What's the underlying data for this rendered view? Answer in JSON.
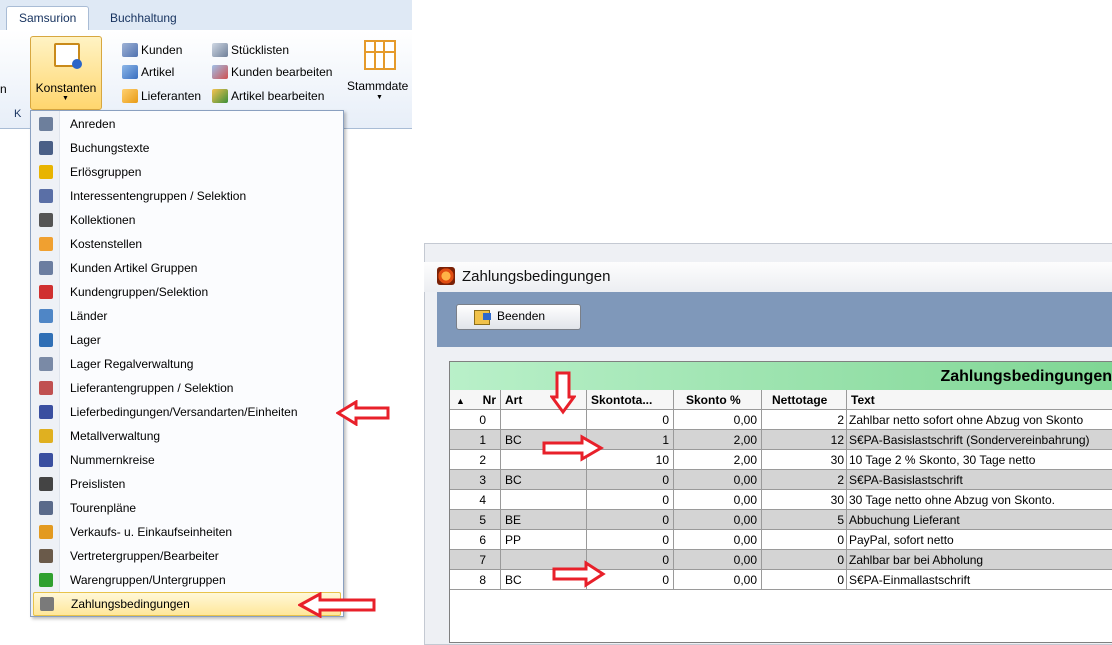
{
  "ribbon": {
    "tabs": [
      {
        "label": "Samsurion",
        "active": true
      },
      {
        "label": "Buchhaltung",
        "active": false
      }
    ],
    "constants_button": "Konstanten",
    "small_buttons": [
      {
        "label": "Kunden",
        "icon": "customers-icon"
      },
      {
        "label": "Artikel",
        "icon": "article-icon"
      },
      {
        "label": "Lieferanten",
        "icon": "suppliers-icon"
      },
      {
        "label": "Stücklisten",
        "icon": "bill-of-materials-icon"
      },
      {
        "label": "Kunden bearbeiten",
        "icon": "edit-customers-icon"
      },
      {
        "label": "Artikel bearbeiten",
        "icon": "edit-articles-icon"
      }
    ],
    "stammdaten_label": "Stammdate",
    "left_edge_text": "n",
    "group_label": "K"
  },
  "menu": {
    "items": [
      {
        "label": "Anreden",
        "icon": "people-icon",
        "color": "#6d7f9c"
      },
      {
        "label": "Buchungstexte",
        "icon": "text-lines-icon",
        "color": "#4a5f86"
      },
      {
        "label": "Erlösgruppen",
        "icon": "star-burst-icon",
        "color": "#e8b400"
      },
      {
        "label": "Interessentengruppen / Selektion",
        "icon": "person-question-icon",
        "color": "#5a6fa6"
      },
      {
        "label": "Kollektionen",
        "icon": "caret-up-icon",
        "color": "#555555"
      },
      {
        "label": "Kostenstellen",
        "icon": "grid-orange-icon",
        "color": "#f0a030"
      },
      {
        "label": "Kunden Artikel Gruppen",
        "icon": "customer-article-icon",
        "color": "#6b7da0"
      },
      {
        "label": "Kundengruppen/Selektion",
        "icon": "colored-people-icon",
        "color": "#d03030"
      },
      {
        "label": "Länder",
        "icon": "landscape-icon",
        "color": "#4f86c6"
      },
      {
        "label": "Lager",
        "icon": "box-icon",
        "color": "#2f6fb5"
      },
      {
        "label": "Lager Regalverwaltung",
        "icon": "shelf-icon",
        "color": "#7a8aa6"
      },
      {
        "label": "Lieferantengruppen / Selektion",
        "icon": "supplier-group-icon",
        "color": "#c05050"
      },
      {
        "label": "Lieferbedingungen/Versandarten/Einheiten",
        "icon": "code-brackets-icon",
        "color": "#3a4fa0"
      },
      {
        "label": "Metallverwaltung",
        "icon": "metal-icon",
        "color": "#e0b020"
      },
      {
        "label": "Nummernkreise",
        "icon": "code-brackets-icon",
        "color": "#3a4fa0"
      },
      {
        "label": "Preislisten",
        "icon": "list-icon",
        "color": "#444444"
      },
      {
        "label": "Tourenpläne",
        "icon": "route-icon",
        "color": "#5a6a8a"
      },
      {
        "label": "Verkaufs- u. Einkaufseinheiten",
        "icon": "units-icon",
        "color": "#e39a20"
      },
      {
        "label": "Vertretergruppen/Bearbeiter",
        "icon": "agent-icon",
        "color": "#6a5a4a"
      },
      {
        "label": "Warengruppen/Untergruppen",
        "icon": "plus-icon",
        "color": "#2fa02f"
      },
      {
        "label": "Zahlungsbedingungen",
        "icon": "payment-terms-icon",
        "color": "#7a7a7a"
      }
    ],
    "highlighted": "Zahlungsbedingungen"
  },
  "window": {
    "title": "Zahlungsbedingungen",
    "close_button": "Beenden",
    "grid_title": "Zahlungsbedingungen",
    "columns": [
      "Nr",
      "Art",
      "Skontota...",
      "Skonto %",
      "Nettotage",
      "Text"
    ],
    "sort_indicator": "▲",
    "rows": [
      {
        "nr": "0",
        "art": "",
        "skontotage": "0",
        "skonto": "0,00",
        "nettotage": "2",
        "text": "Zahlbar netto sofort ohne Abzug von Skonto"
      },
      {
        "nr": "1",
        "art": "BC",
        "skontotage": "1",
        "skonto": "2,00",
        "nettotage": "12",
        "text": "S€PA-Basislastschrift (Sondervereinbahrung)"
      },
      {
        "nr": "2",
        "art": "",
        "skontotage": "10",
        "skonto": "2,00",
        "nettotage": "30",
        "text": "10 Tage 2 % Skonto, 30 Tage netto"
      },
      {
        "nr": "3",
        "art": "BC",
        "skontotage": "0",
        "skonto": "0,00",
        "nettotage": "2",
        "text": "S€PA-Basislastschrift"
      },
      {
        "nr": "4",
        "art": "",
        "skontotage": "0",
        "skonto": "0,00",
        "nettotage": "30",
        "text": "30 Tage netto ohne Abzug von Skonto."
      },
      {
        "nr": "5",
        "art": "BE",
        "skontotage": "0",
        "skonto": "0,00",
        "nettotage": "5",
        "text": "Abbuchung Lieferant"
      },
      {
        "nr": "6",
        "art": "PP",
        "skontotage": "0",
        "skonto": "0,00",
        "nettotage": "0",
        "text": "PayPal, sofort netto"
      },
      {
        "nr": "7",
        "art": "",
        "skontotage": "0",
        "skonto": "0,00",
        "nettotage": "0",
        "text": "Zahlbar bar bei Abholung"
      },
      {
        "nr": "8",
        "art": "BC",
        "skontotage": "0",
        "skonto": "0,00",
        "nettotage": "0",
        "text": "S€PA-Einmallastschrift"
      }
    ]
  },
  "colors": {
    "annotation_arrow": "#e8202a",
    "grid_title_bg": "#8fdca4",
    "toolbar_bg": "#7f98ba",
    "row_alt_bg": "#d4d4d4"
  }
}
